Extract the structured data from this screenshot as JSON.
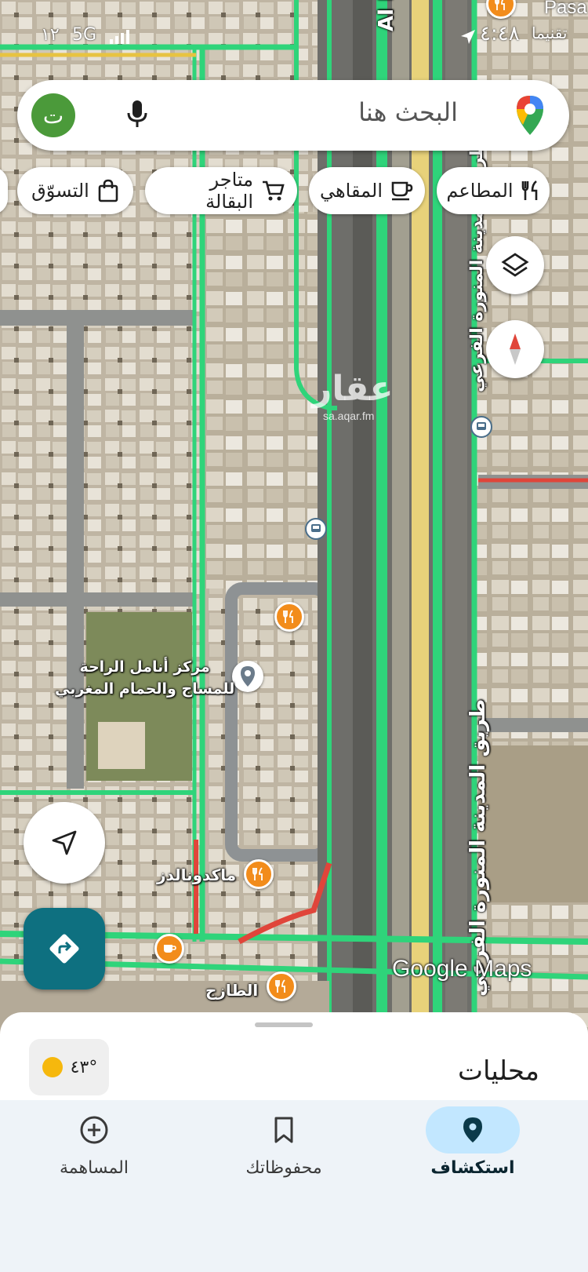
{
  "status_bar": {
    "time": "٤:٤٨",
    "network": "5G",
    "signal_text": "١٢"
  },
  "search": {
    "placeholder": "البحث هنا",
    "avatar_letter": "ت"
  },
  "chips": [
    {
      "label": "المطاعم",
      "icon": "restaurant-icon"
    },
    {
      "label": "المقاهي",
      "icon": "coffee-icon"
    },
    {
      "label": "متاجر البقالة",
      "icon": "cart-icon"
    },
    {
      "label": "التسوّق",
      "icon": "shopping-bag-icon"
    }
  ],
  "map": {
    "road_top": "Al Madi",
    "road_east_top": "طريق المدينة المنورة الفرعي",
    "road_east_bottom": "طريق المدينة المنورة الفرعي",
    "place_name": "مركز أنامل الراحة\nللمساج والحمام المغربي",
    "poi_mcdonalds": "ماكدونالدز",
    "poi_altazaj": "الطازج",
    "watermark": "عقار",
    "watermark_url": "sa.aqar.fm",
    "corner_label": "Pasa",
    "corner_sublabel": "تقنيما",
    "attribution": "Google Maps"
  },
  "sheet": {
    "title": "محليات",
    "weather": "٤٣°"
  },
  "nav": [
    {
      "label": "استكشاف",
      "icon": "location-pin-icon",
      "active": true
    },
    {
      "label": "محفوظاتك",
      "icon": "bookmark-icon",
      "active": false
    },
    {
      "label": "المساهمة",
      "icon": "add-circle-icon",
      "active": false
    }
  ],
  "colors": {
    "traffic_green": "#2fd47a",
    "traffic_red": "#e0453a",
    "highway_yellow": "#e8d27a",
    "nav_active": "#c2e7ff",
    "directions_teal": "#0e7080",
    "poi_orange": "#f28c1b"
  }
}
